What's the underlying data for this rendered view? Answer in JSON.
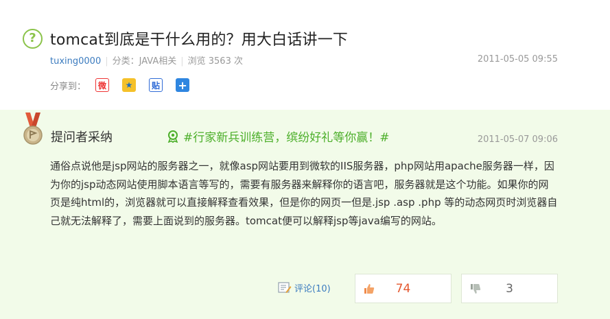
{
  "question": {
    "icon": "question-icon",
    "title": "tomcat到底是干什么用的？用大白话讲一下",
    "author": "tuxing0000",
    "category": "分类：JAVA相关",
    "views": "浏览 3563 次",
    "date": "2011-05-05 09:55",
    "share_label": "分享到：",
    "share_buttons": [
      {
        "icon": "weibo-icon",
        "glyph": "微"
      },
      {
        "icon": "qzone-icon",
        "glyph": "★"
      },
      {
        "icon": "tieba-icon",
        "glyph": "贴"
      },
      {
        "icon": "more-share-icon",
        "glyph": "+"
      }
    ]
  },
  "answer": {
    "badge_icon": "medal-icon",
    "adopted_label": "提问者采纳",
    "promo_icon": "promo-icon",
    "promo_text": "#行家新兵训练营，缤纷好礼等你赢！#",
    "date": "2011-05-07 09:06",
    "body": "通俗点说他是jsp网站的服务器之一，就像asp网站要用到微软的IIS服务器，php网站用apache服务器一样，因为你的jsp动态网站使用脚本语言等写的，需要有服务器来解释你的语言吧，服务器就是这个功能。如果你的网页是纯html的，浏览器就可以直接解释查看效果，但是你的网页一但是.jsp .asp .php 等的动态网页时浏览器自己就无法解释了，需要上面说到的服务器。tomcat便可以解释jsp等java编写的网站。",
    "comment_label": "评论(10)",
    "upvotes": "74",
    "downvotes": "3"
  },
  "colors": {
    "accent_green": "#8bc34a",
    "promo_green": "#4caf2a",
    "link_blue": "#3b7bbf",
    "answer_bg": "#f2fbe9",
    "upvote_red": "#e4572e"
  }
}
